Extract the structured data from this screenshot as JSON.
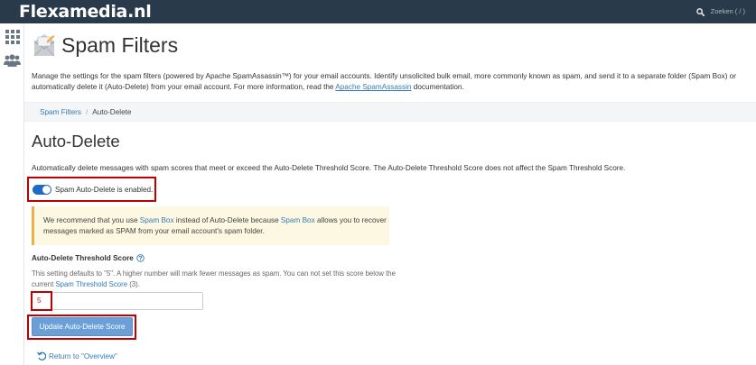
{
  "topbar": {
    "brand": "Flexamedia.nl",
    "search_placeholder": "Zoeken ( / )",
    "search_icon": "search-icon"
  },
  "sidebar": {
    "items": [
      {
        "icon": "apps-grid-icon"
      },
      {
        "icon": "users-icon"
      }
    ]
  },
  "page": {
    "icon": "spam-envelope-icon",
    "title": "Spam Filters",
    "intro_text": "Manage the settings for the spam filters (powered by Apache SpamAssassin™) for your email accounts. Identify unsolicited bulk email, more commonly known as spam, and send it to a separate folder (Spam Box) or automatically delete it (Auto-Delete) from your email account. For more information, read the",
    "intro_link": "Apache SpamAssassin",
    "intro_end": " documentation."
  },
  "breadcrumb": {
    "parent": "Spam Filters",
    "separator": "/",
    "current": "Auto-Delete"
  },
  "section": {
    "title": "Auto-Delete",
    "description": "Automatically delete messages with spam scores that meet or exceed the Auto-Delete Threshold Score. The Auto-Delete Threshold Score does not affect the Spam Threshold Score."
  },
  "toggle": {
    "enabled": true,
    "label": "Spam Auto-Delete is enabled."
  },
  "alert": {
    "text_1": "We recommend that you use ",
    "link_1": "Spam Box",
    "text_2": " instead of Auto-Delete because ",
    "link_2": "Spam Box",
    "text_3": " allows you to recover messages marked as SPAM from your email account's spam folder."
  },
  "threshold": {
    "label": "Auto-Delete Threshold Score",
    "help_icon": "question-circle-icon",
    "help_text_1": "This setting defaults to \"5\". A higher number will mark fewer messages as spam. You can not set this score below the current ",
    "help_link": "Spam Threshold Score",
    "help_text_2": " (3).",
    "value": "5"
  },
  "buttons": {
    "update": "Update Auto-Delete Score",
    "return": "Return to \"Overview\""
  },
  "colors": {
    "topbar": "#293a4a",
    "link": "#357ab7",
    "toggle_on": "#1f6ac5",
    "button": "#6a9fd8",
    "alert_bg": "#fcf8e1",
    "alert_border": "#f0ad4e",
    "highlight": "#c00000"
  }
}
